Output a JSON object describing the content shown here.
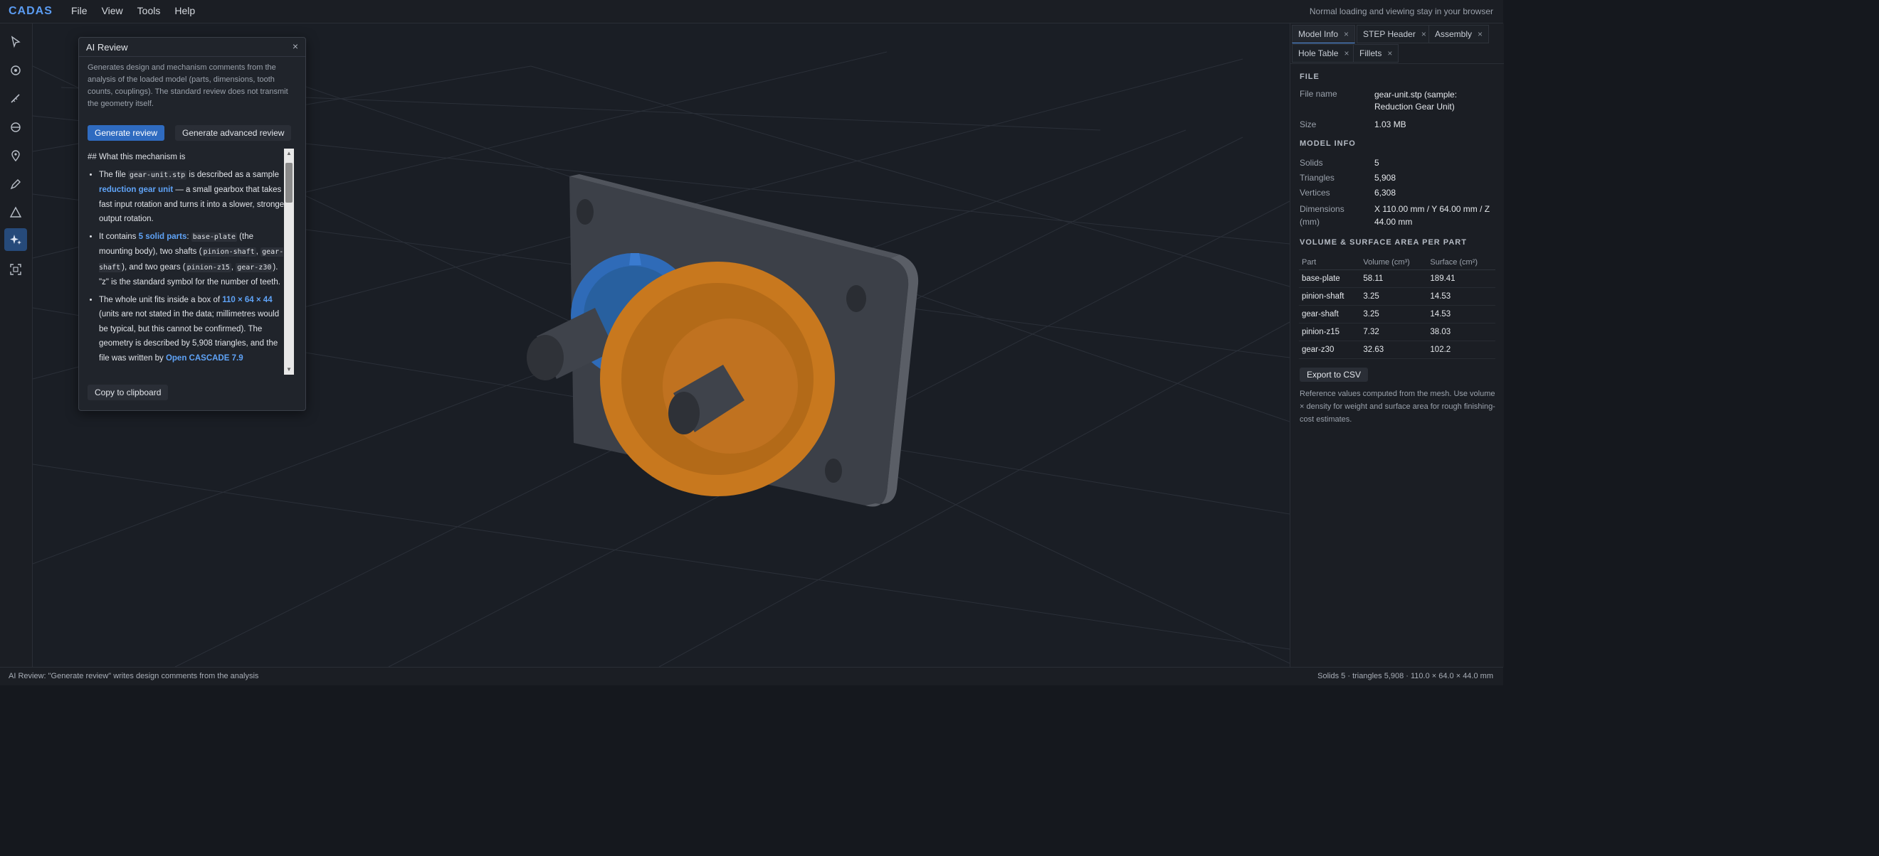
{
  "app": {
    "logo": "CADAS",
    "top_note": "Normal loading and viewing stay in your browser"
  },
  "menu": [
    "File",
    "View",
    "Tools",
    "Help"
  ],
  "toolbar": [
    "pointer-icon",
    "orbit-icon",
    "measure-icon",
    "section-icon",
    "pin-icon",
    "pen-icon",
    "warning-icon",
    "ai-sparkle-icon",
    "fit-view-icon"
  ],
  "ai_review": {
    "title": "AI Review",
    "close": "×",
    "description": "Generates design and mechanism comments from the analysis of the loaded model (parts, dimensions, tooth counts, couplings). The standard review does not transmit the geometry itself.",
    "generate": "Generate review",
    "generate_advanced": "Generate advanced review",
    "heading": "## What this mechanism is",
    "b1": {
      "t1": "The file ",
      "c1": "gear-unit.stp",
      "t2": " is described as a sample ",
      "h1": "reduction gear unit",
      "t3": " — a small gearbox that takes a fast input rotation and turns it into a slower, stronger output rotation."
    },
    "b2": {
      "t1": "It contains ",
      "h1": "5 solid parts",
      "t2": ": ",
      "c1": "base-plate",
      "t3": " (the mounting body), two shafts (",
      "c2": "pinion-shaft",
      "t4": ", ",
      "c3": "gear-shaft",
      "t5": "), and two gears (",
      "c4": "pinion-z15",
      "t6": ", ",
      "c5": "gear-z30",
      "t7": "). \"z\" is the standard symbol for the number of teeth."
    },
    "b3": {
      "t1": "The whole unit fits inside a box of ",
      "h1": "110 × 64 × 44",
      "t2": " (units are not stated in the data; millimetres would be typical, but this cannot be confirmed). The geometry is described by 5,908 triangles, and the file was written by ",
      "h2": "Open CASCADE 7.9"
    },
    "copy": "Copy to clipboard",
    "scroll_up": "▲",
    "scroll_down": "▼"
  },
  "right_panel": {
    "tabs": [
      {
        "label": "Model Info",
        "x": "×"
      },
      {
        "label": "STEP Header",
        "x": "×"
      },
      {
        "label": "Assembly",
        "x": "×"
      },
      {
        "label": "Hole Table",
        "x": "×"
      },
      {
        "label": "Fillets",
        "x": "×"
      }
    ],
    "file_section": "FILE",
    "file_name_label": "File name",
    "file_name_value": "gear-unit.stp (sample: Reduction Gear Unit)",
    "size_label": "Size",
    "size_value": "1.03 MB",
    "model_section": "MODEL INFO",
    "solids_label": "Solids",
    "solids_value": "5",
    "triangles_label": "Triangles",
    "triangles_value": "5,908",
    "vertices_label": "Vertices",
    "vertices_value": "6,308",
    "dimensions_label": "Dimensions (mm)",
    "dimensions_value": "X 110.00 mm / Y 64.00 mm / Z 44.00 mm",
    "volume_section": "VOLUME & SURFACE AREA PER PART",
    "table_headers": [
      "Part",
      "Volume (cm³)",
      "Surface (cm²)"
    ],
    "parts": [
      [
        "base-plate",
        "58.11",
        "189.41"
      ],
      [
        "pinion-shaft",
        "3.25",
        "14.53"
      ],
      [
        "gear-shaft",
        "3.25",
        "14.53"
      ],
      [
        "pinion-z15",
        "7.32",
        "38.03"
      ],
      [
        "gear-z30",
        "32.63",
        "102.2"
      ]
    ],
    "export": "Export to CSV",
    "note": "Reference values computed from the mesh. Use volume × density for weight and surface area for rough finishing-cost estimates."
  },
  "status": {
    "left": "AI Review: \"Generate review\" writes design comments from the analysis",
    "right": "Solids 5 · triangles 5,908 · 110.0 × 64.0 × 44.0 mm"
  },
  "colors": {
    "accent": "#5b9cf2",
    "gear_orange": "#c8781e",
    "gear_blue": "#2f6bb8",
    "plate": "#4a4e56"
  }
}
